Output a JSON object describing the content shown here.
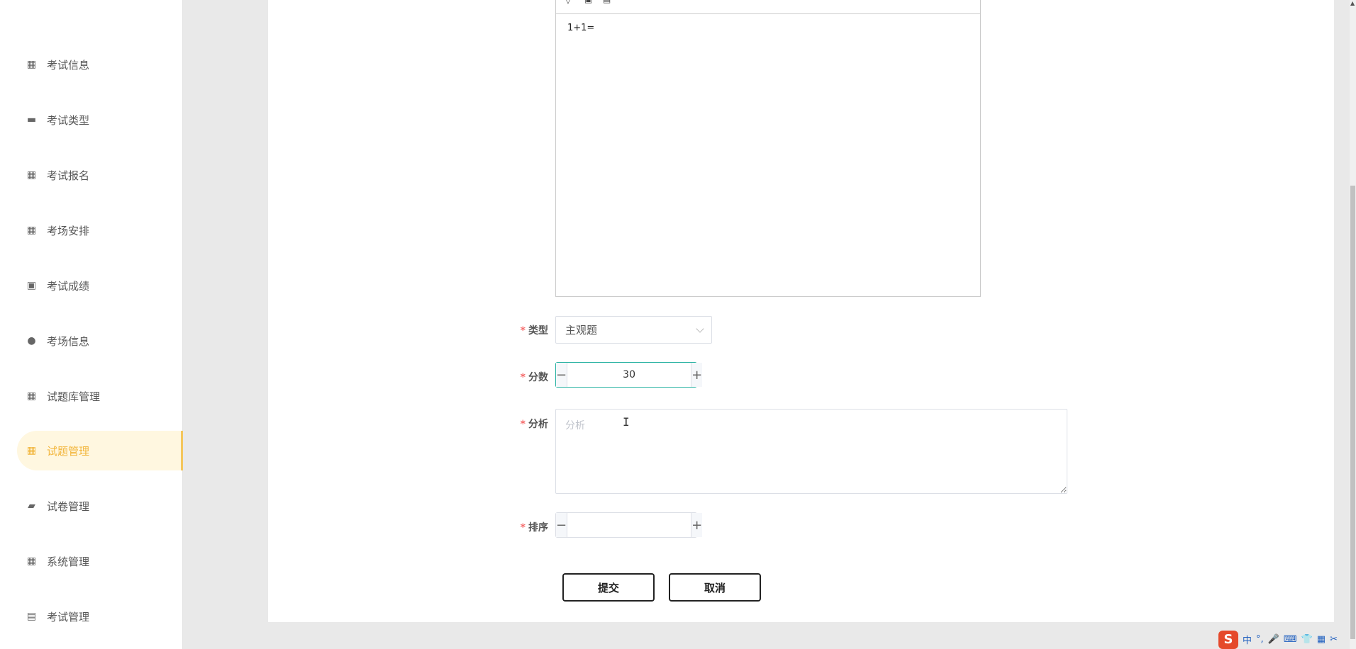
{
  "sidebar": {
    "items": [
      {
        "label": "考试信息",
        "icon": "grid-icon"
      },
      {
        "label": "考试类型",
        "icon": "ticket-icon"
      },
      {
        "label": "考试报名",
        "icon": "grid-icon"
      },
      {
        "label": "考场安排",
        "icon": "grid-icon"
      },
      {
        "label": "考试成绩",
        "icon": "clipboard-x-icon"
      },
      {
        "label": "考场信息",
        "icon": "leaf-icon"
      },
      {
        "label": "试题库管理",
        "icon": "grid-icon"
      },
      {
        "label": "试题管理",
        "icon": "grid-icon",
        "active": true
      },
      {
        "label": "试卷管理",
        "icon": "wallet-icon"
      },
      {
        "label": "系统管理",
        "icon": "grid-icon"
      },
      {
        "label": "考试管理",
        "icon": "briefcase-icon"
      }
    ]
  },
  "editor": {
    "content": "1+1="
  },
  "form": {
    "type": {
      "label": "类型",
      "value": "主观题"
    },
    "score": {
      "label": "分数",
      "value": "30",
      "minus": "−",
      "plus": "+"
    },
    "analysis": {
      "label": "分析",
      "placeholder": "分析"
    },
    "order": {
      "label": "排序",
      "value": "",
      "minus": "−",
      "plus": "+"
    },
    "required_mark": "*"
  },
  "actions": {
    "submit": "提交",
    "cancel": "取消"
  },
  "ime": {
    "logo": "S",
    "items": [
      "中",
      "°,",
      "🎤",
      "⌨",
      "👕",
      "▦",
      "✂"
    ]
  },
  "colors": {
    "accent": "#f2b53a",
    "active_bg": "#fff7e0",
    "focus": "#2bb3a3",
    "required": "#f56c6c"
  }
}
